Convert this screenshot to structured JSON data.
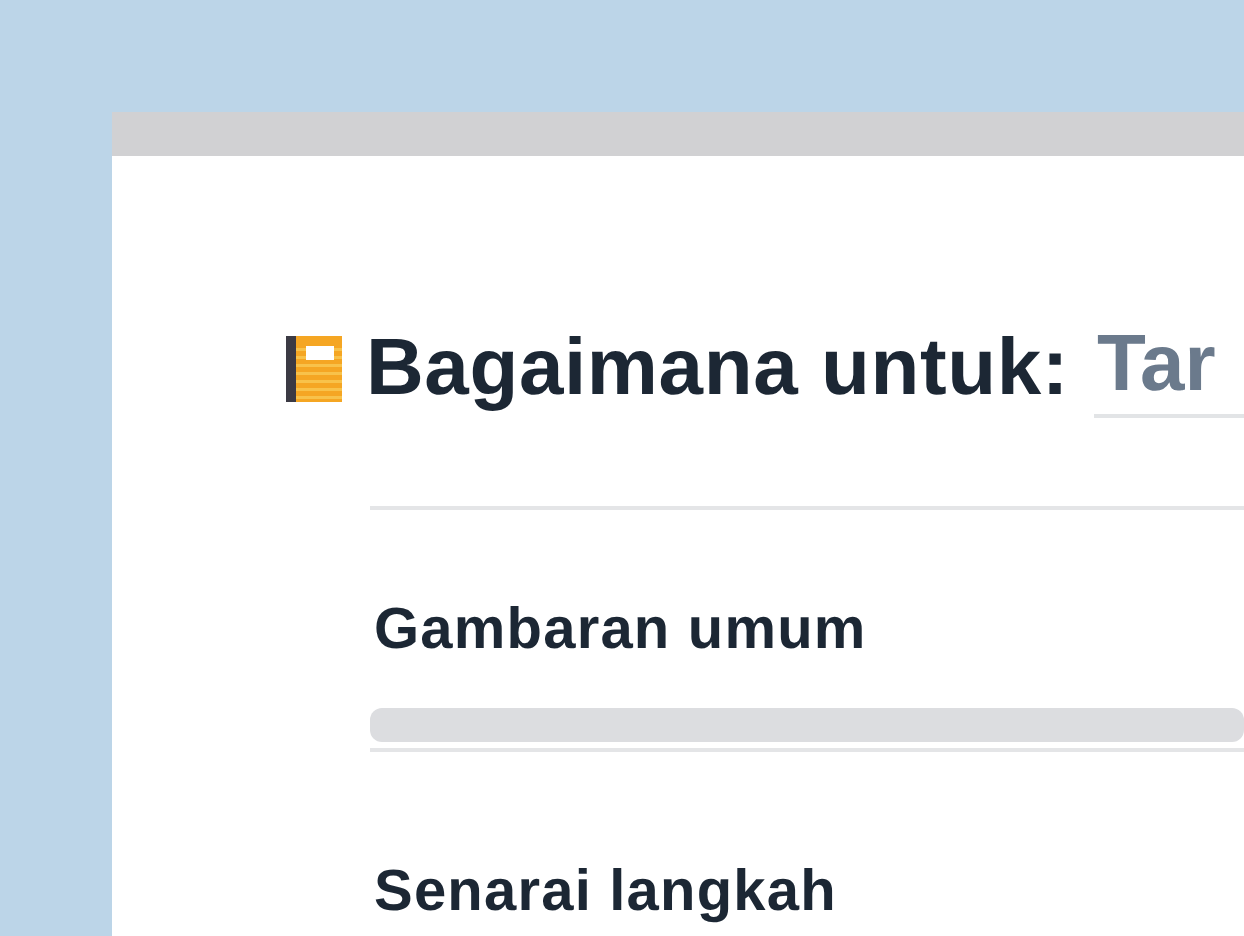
{
  "title": {
    "label": "Bagaimana untuk:",
    "value": "Tar"
  },
  "sections": [
    {
      "heading": "Gambaran umum"
    },
    {
      "heading": "Senarai langkah"
    }
  ]
}
